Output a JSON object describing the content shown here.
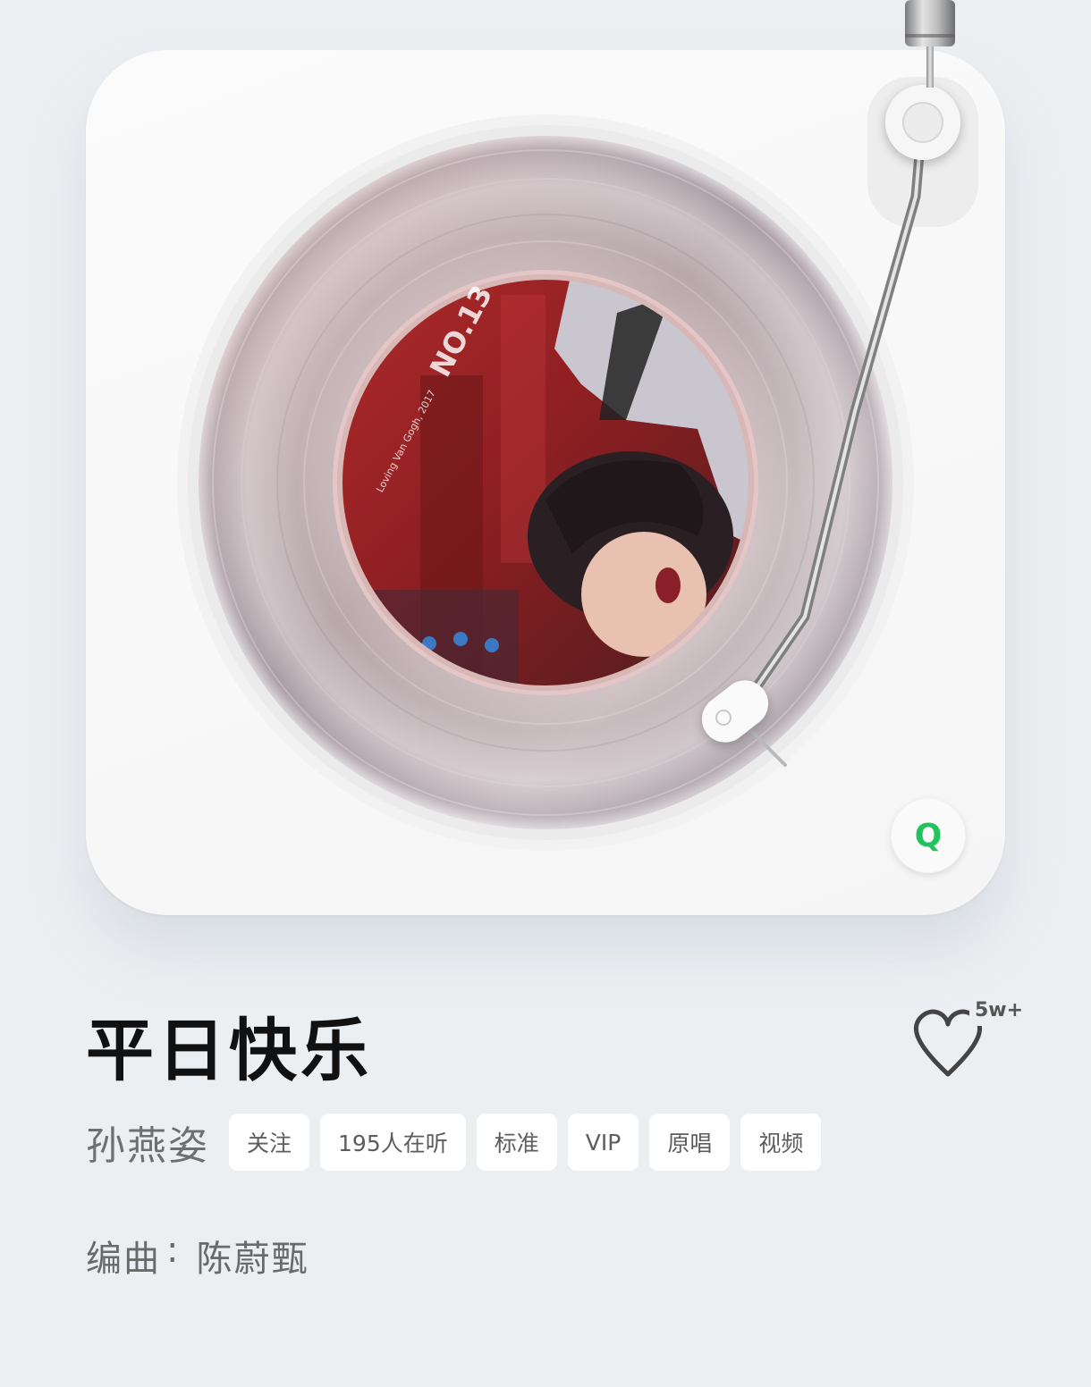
{
  "player": {
    "cover": {
      "label_big": "NO.13",
      "label_small": "Loving Van Gogh, 2017"
    },
    "app_badge": {
      "letter": "Q",
      "icon": "qq-music-logo-icon",
      "color": "#22c25e"
    }
  },
  "song": {
    "title": "平日快乐",
    "artist": "孙燕姿",
    "like_count": "5w+",
    "like_icon": "heart-outline-icon",
    "tags": {
      "follow": "关注",
      "listeners": "195人在听",
      "quality": "标准",
      "vip": "VIP",
      "original": "原唱",
      "video": "视频"
    },
    "credit": {
      "label": "编曲",
      "separator": ":",
      "value": "陈蔚甄"
    }
  },
  "colors": {
    "background": "#eceff2",
    "card": "#f7f7f7",
    "title": "#111111",
    "muted_text": "#6f6f6f",
    "accent_green": "#22c25e"
  }
}
